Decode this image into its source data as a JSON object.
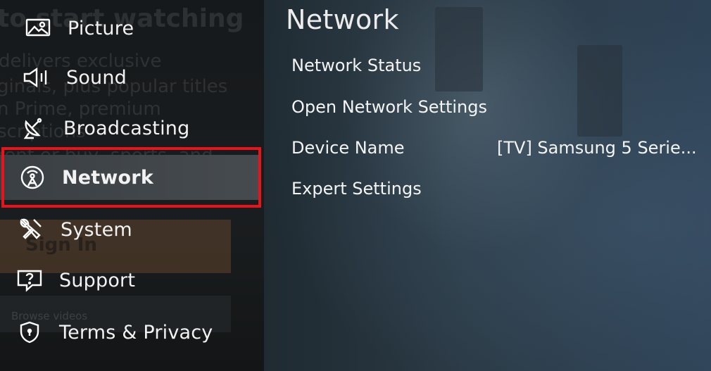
{
  "menu": {
    "items": [
      {
        "label": "Picture",
        "icon": "picture-icon"
      },
      {
        "label": "Sound",
        "icon": "speaker-icon"
      },
      {
        "label": "Broadcasting",
        "icon": "satellite-dish-icon"
      },
      {
        "label": "Network",
        "icon": "network-antenna-icon",
        "selected": true
      },
      {
        "label": "System",
        "icon": "tools-icon"
      },
      {
        "label": "Support",
        "icon": "help-icon"
      },
      {
        "label": "Terms & Privacy",
        "icon": "shield-icon"
      }
    ]
  },
  "panel": {
    "title": "Network",
    "settings": [
      {
        "label": "Network Status"
      },
      {
        "label": "Open Network Settings"
      },
      {
        "label": "Device Name",
        "value": "[TV] Samsung 5 Serie..."
      },
      {
        "label": "Expert Settings"
      }
    ]
  },
  "background": {
    "heading": "to start watching",
    "lines": [
      "delivers exclusive",
      "ginals, plus popular titles",
      "n Prime, premium",
      "scriptions",
      "rent or buy, sports, and"
    ],
    "button": "Sign In",
    "caption": "Browse videos"
  },
  "colors": {
    "highlight_border": "#e8141c",
    "menu_bg": "#1a1d1f",
    "selected_bg": "#44494d",
    "panel_bg": "#2a3944"
  }
}
